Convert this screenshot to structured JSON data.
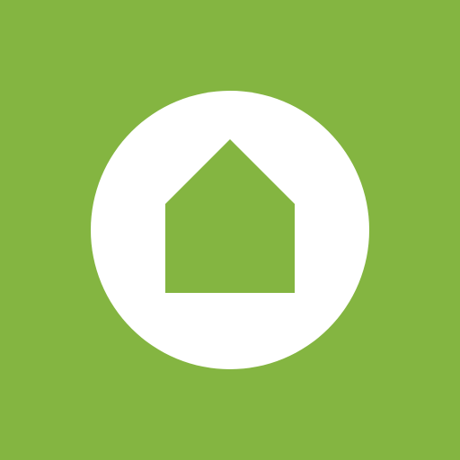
{
  "icon": {
    "name": "home-icon",
    "background_color": "#84b541",
    "circle_color": "#ffffff",
    "house_color": "#84b541"
  }
}
